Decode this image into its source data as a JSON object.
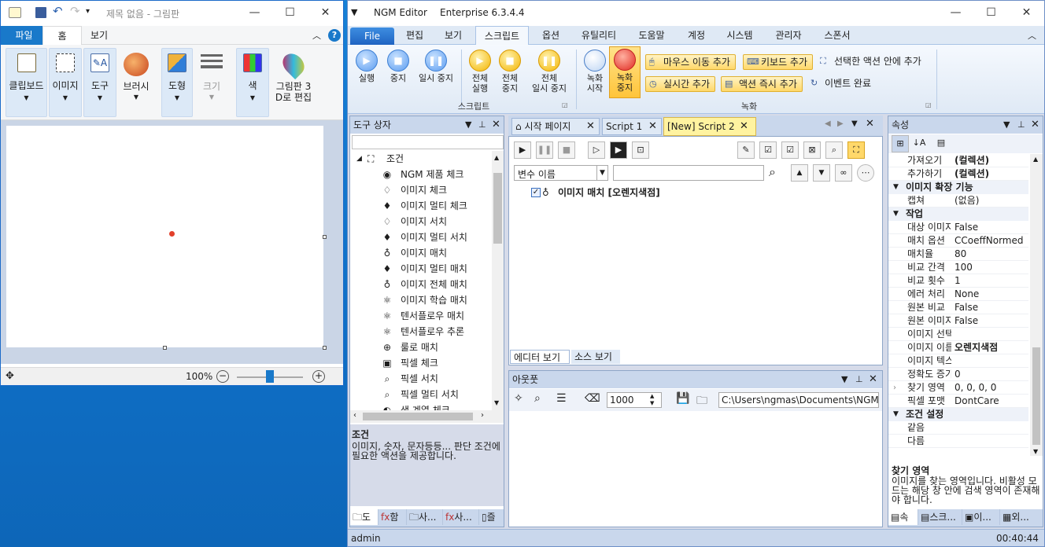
{
  "paint": {
    "title": "제목 없음 - 그림판",
    "tabs": {
      "file": "파일",
      "home": "홈",
      "view": "보기"
    },
    "groups": [
      {
        "label": "클립보드",
        "icon": "clipboard-icon"
      },
      {
        "label": "이미지",
        "icon": "select-icon"
      },
      {
        "label": "도구",
        "icon": "tools-icon"
      },
      {
        "label": "브러시",
        "icon": "brush-icon"
      },
      {
        "label": "도형",
        "icon": "shapes-icon"
      },
      {
        "label": "크기",
        "icon": "size-icon"
      },
      {
        "label": "색",
        "icon": "color-icon"
      },
      {
        "label": "그림판 3D로 편집",
        "label1": "그림판 3",
        "label2": "D로 편집",
        "icon": "paint3d-icon"
      }
    ],
    "zoom": "100%",
    "colors": {
      "accent": "#1979ca",
      "dot": "#e2402b"
    }
  },
  "ngm": {
    "title": "NGM Editor",
    "edition": "Enterprise 6.3.4.4",
    "menu": [
      "File",
      "편집",
      "보기",
      "스크립트",
      "옵션",
      "유틸리티",
      "도움말",
      "계정",
      "시스템",
      "관리자",
      "스폰서"
    ],
    "ribbon": {
      "run": "실행",
      "stop": "중지",
      "pause": "일시 중지",
      "run_all_1": "전체",
      "run_all_2": "실행",
      "stop_all_1": "전체",
      "stop_all_2": "중지",
      "pause_all_1": "전체",
      "pause_all_2": "일시 중지",
      "script_group": "스크립트",
      "rec_start_1": "녹화",
      "rec_start_2": "시작",
      "rec_stop_1": "녹화",
      "rec_stop_2": "중지",
      "mouse_move": "마우스 이동 추가",
      "keyboard": "키보드 추가",
      "add_in_selected": "선택한 액션 안에 추가",
      "realtime": "실시간 추가",
      "action_now": "액션 즉시 추가",
      "event_done": "이벤트 완료",
      "rec_group": "녹화"
    },
    "toolbox": {
      "title": "도구 상자",
      "root": "조건",
      "items": [
        {
          "label": "NGM 제품 체크",
          "icon": "ngm-logo-icon"
        },
        {
          "label": "이미지 체크",
          "icon": "drop-outline-icon"
        },
        {
          "label": "이미지 멀티 체크",
          "icon": "drop-filled-icon"
        },
        {
          "label": "이미지 서치",
          "icon": "drops-outline-icon"
        },
        {
          "label": "이미지 멀티 서치",
          "icon": "drops-filled-icon"
        },
        {
          "label": "이미지 매치",
          "icon": "drops-triple-icon"
        },
        {
          "label": "이미지 멀티 매치",
          "icon": "drops-triple-filled-icon"
        },
        {
          "label": "이미지 전체 매치",
          "icon": "drops-triple-icon"
        },
        {
          "label": "이미지 학습 매치",
          "icon": "atom-icon"
        },
        {
          "label": "텐서플로우 매치",
          "icon": "atom-icon"
        },
        {
          "label": "텐서플로우 추론",
          "icon": "atom-icon"
        },
        {
          "label": "룰로 매치",
          "icon": "compass-icon"
        },
        {
          "label": "픽셀 체크",
          "icon": "camera-icon"
        },
        {
          "label": "픽셀 서치",
          "icon": "magnifier-icon"
        },
        {
          "label": "픽셀 멀티 서치",
          "icon": "magnifier-icon"
        },
        {
          "label": "색 계열 체크",
          "icon": "palette-icon"
        }
      ],
      "desc_title": "조건",
      "desc_text": "이미지, 숫자, 문자등등... 판단 조건에 필요한 액션을 제공합니다.",
      "bottom_tabs": [
        "도",
        "함",
        "사...",
        "사...",
        "즐"
      ]
    },
    "editor": {
      "tabs": [
        "시작 페이지",
        "Script 1",
        "[New] Script 2"
      ],
      "var_placeholder": "변수 이름",
      "script_line_label": "이미지 매치 [오렌지색점]",
      "view_tabs": [
        "에디터 보기",
        "소스 보기"
      ]
    },
    "output": {
      "title": "아웃풋",
      "count": "1000",
      "path": "C:\\Users\\ngmas\\Documents\\NGM6\\"
    },
    "props": {
      "title": "속성",
      "rows": [
        {
          "k": "가져오기",
          "v": "(컬렉션)",
          "bold": true
        },
        {
          "k": "추가하기",
          "v": "(컬렉션)",
          "bold": true
        },
        {
          "cat": "이미지 확장 기능"
        },
        {
          "k": "캡쳐",
          "v": "(없음)"
        },
        {
          "cat": "작업"
        },
        {
          "k": "대상 이미지",
          "v": "False"
        },
        {
          "k": "매치 옵션",
          "v": "CCoeffNormed"
        },
        {
          "k": "매치율",
          "v": "80"
        },
        {
          "k": "비교 간격",
          "v": "100"
        },
        {
          "k": "비교 횟수",
          "v": "1"
        },
        {
          "k": "에러 처리",
          "v": "None"
        },
        {
          "k": "원본 비교",
          "v": "False"
        },
        {
          "k": "원본 이미지",
          "v": "False"
        },
        {
          "k": "이미지 선택",
          "v": ""
        },
        {
          "k": "이미지 이름",
          "v": "오렌지색점",
          "bold": true
        },
        {
          "k": "이미지 텍스트",
          "v": ""
        },
        {
          "k": "정확도 증가",
          "v": "0"
        },
        {
          "k": "찾기 영역",
          "v": "0, 0, 0, 0"
        },
        {
          "k": "픽셀 포맷",
          "v": "DontCare"
        },
        {
          "cat": "조건 설정"
        },
        {
          "k": "같음",
          "v": ""
        },
        {
          "k": "다름",
          "v": ""
        }
      ],
      "desc_title": "찾기 영역",
      "desc_text": "이미지를 찾는 영역입니다. 비활성 모드는 해당 창 안에 검색 영역이 존재해야 합니다.",
      "bottom_tabs": [
        "속",
        "스크...",
        "이...",
        "외..."
      ]
    },
    "status": {
      "user": "admin",
      "time": "00:40:44"
    },
    "colors": {
      "accent": "#1f63c2",
      "highlight": "#ffd86a",
      "tab_active": "#fff3a0"
    }
  }
}
